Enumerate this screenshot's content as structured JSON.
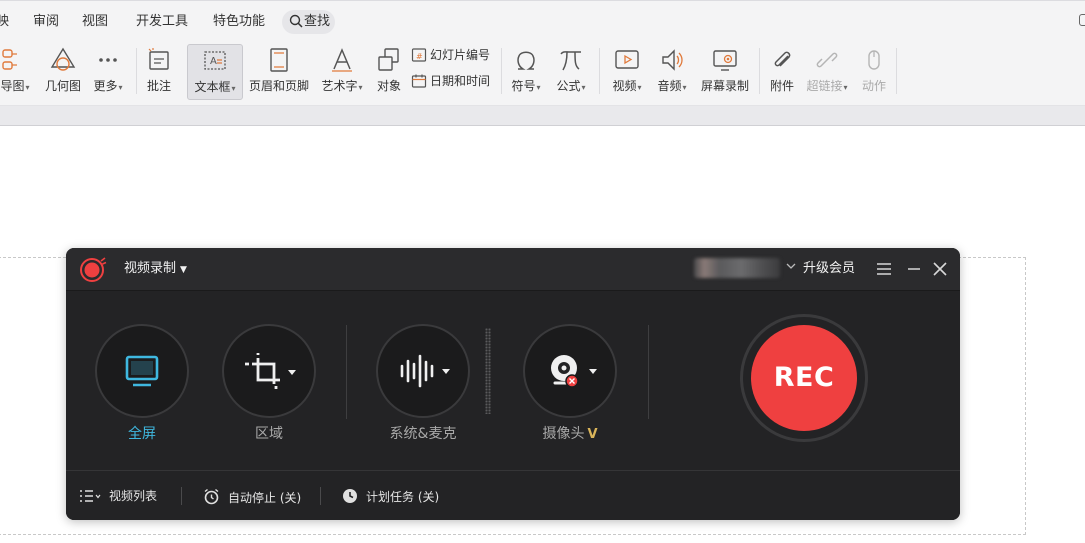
{
  "ribbon": {
    "menu": [
      "映",
      "审阅",
      "视图",
      "开发工具",
      "特色功能"
    ],
    "search_label": "查找",
    "tools": {
      "mindmap": "导图",
      "shapes": "几何图",
      "more": "更多",
      "comment": "批注",
      "textbox": "文本框",
      "header_footer": "页眉和页脚",
      "wordart": "艺术字",
      "object": "对象",
      "slide_number": "幻灯片编号",
      "date_time": "日期和时间",
      "symbol": "符号",
      "formula": "公式",
      "video": "视频",
      "audio": "音频",
      "screen_record": "屏幕录制",
      "attachment": "附件",
      "hyperlink": "超链接",
      "action": "动作"
    },
    "caret": "▾"
  },
  "recorder": {
    "mode_label": "视频录制",
    "mode_caret": "▼",
    "vip_label": "升级会员",
    "modes": {
      "fullscreen": "全屏",
      "region": "区域",
      "audio": "系统&麦克",
      "webcam": "摄像头",
      "webcam_badge": "V"
    },
    "rec_label": "REC",
    "footer": {
      "video_list": "视频列表",
      "auto_stop": "自动停止 (关)",
      "schedule": "计划任务 (关)"
    },
    "colors": {
      "accent": "#3fb8e0",
      "rec": "#ef4040",
      "window_bg": "#232325",
      "vip_gold": "#d9b45a"
    }
  }
}
